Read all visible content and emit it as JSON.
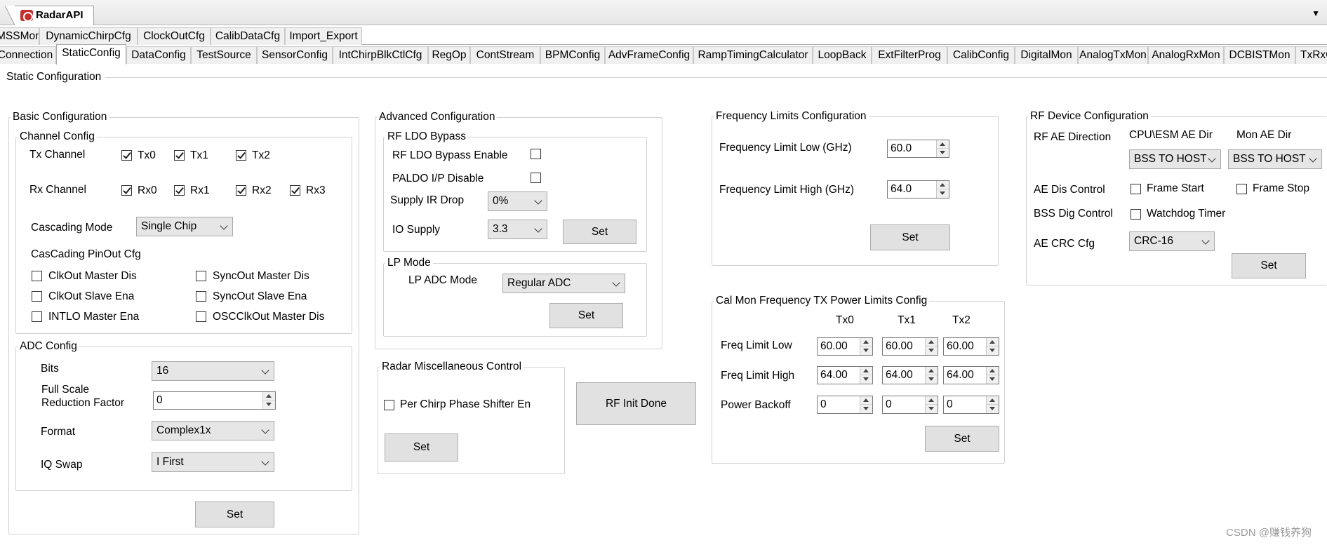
{
  "window": {
    "app_title": "RadarAPI",
    "dropdown_glyph": "▼"
  },
  "tabs_row1": [
    "MSSMon",
    "DynamicChirpCfg",
    "ClockOutCfg",
    "CalibDataCfg",
    "Import_Export"
  ],
  "tabs_row2": [
    "Connection",
    "StaticConfig",
    "DataConfig",
    "TestSource",
    "SensorConfig",
    "IntChirpBlkCtlCfg",
    "RegOp",
    "ContStream",
    "BPMConfig",
    "AdvFrameConfig",
    "RampTimingCalculator",
    "LoopBack",
    "ExtFilterProg",
    "CalibConfig",
    "DigitalMon",
    "AnalogTxMon",
    "AnalogRxMon",
    "DCBISTMon",
    "TxRxG"
  ],
  "active_tab": "StaticConfig",
  "panel_title": "Static Configuration",
  "basic": {
    "title": "Basic Configuration",
    "channel_title": "Channel Config",
    "tx_label": "Tx Channel",
    "tx": [
      {
        "label": "Tx0",
        "checked": true
      },
      {
        "label": "Tx1",
        "checked": true
      },
      {
        "label": "Tx2",
        "checked": true
      }
    ],
    "rx_label": "Rx Channel",
    "rx": [
      {
        "label": "Rx0",
        "checked": true
      },
      {
        "label": "Rx1",
        "checked": true
      },
      {
        "label": "Rx2",
        "checked": true
      },
      {
        "label": "Rx3",
        "checked": true
      }
    ],
    "cascading_label": "Cascading Mode",
    "cascading_value": "Single Chip",
    "pinout_label": "CasCading PinOut Cfg",
    "pinout": [
      "ClkOut Master Dis",
      "SyncOut Master Dis",
      "ClkOut Slave Ena",
      "SyncOut Slave Ena",
      "INTLO Master Ena",
      "OSCClkOut Master Dis"
    ],
    "adc_title": "ADC Config",
    "bits_label": "Bits",
    "bits_value": "16",
    "fsrf_label1": "Full Scale",
    "fsrf_label2": "Reduction Factor",
    "fsrf_value": "0",
    "format_label": "Format",
    "format_value": "Complex1x",
    "iq_label": "IQ Swap",
    "iq_value": "I First",
    "set": "Set"
  },
  "advanced": {
    "title": "Advanced Configuration",
    "ldo_title": "RF LDO Bypass",
    "ldo_enable": "RF LDO Bypass Enable",
    "paldo": "PALDO I/P Disable",
    "ir_drop_label": "Supply IR Drop",
    "ir_drop_value": "0%",
    "io_label": "IO Supply",
    "io_value": "3.3",
    "set": "Set",
    "lp_title": "LP Mode",
    "lp_adc_label": "LP ADC Mode",
    "lp_adc_value": "Regular ADC",
    "lp_set": "Set"
  },
  "misc": {
    "title": "Radar Miscellaneous Control",
    "per_chirp": "Per Chirp Phase Shifter En",
    "set": "Set",
    "rf_init": "RF Init Done"
  },
  "freq": {
    "title": "Frequency Limits Configuration",
    "low_label": "Frequency Limit Low (GHz)",
    "low_value": "60.0",
    "high_label": "Frequency Limit High (GHz)",
    "high_value": "64.0",
    "set": "Set"
  },
  "calmon": {
    "title": "Cal Mon Frequency TX Power Limits Config",
    "cols": [
      "Tx0",
      "Tx1",
      "Tx2"
    ],
    "rows": [
      {
        "label": "Freq Limit Low",
        "values": [
          "60.00",
          "60.00",
          "60.00"
        ]
      },
      {
        "label": "Freq Limit High",
        "values": [
          "64.00",
          "64.00",
          "64.00"
        ]
      },
      {
        "label": "Power Backoff",
        "values": [
          "0",
          "0",
          "0"
        ]
      }
    ],
    "set": "Set"
  },
  "rfdev": {
    "title": "RF Device Configuration",
    "ae_dir_label": "RF AE Direction",
    "cpu_label": "CPU\\ESM AE Dir",
    "mon_label": "Mon AE Dir",
    "cpu_value": "BSS TO HOST",
    "mon_value": "BSS TO HOST",
    "ae_dis_label": "AE Dis Control",
    "frame_start": "Frame Start",
    "frame_stop": "Frame Stop",
    "bss_dig_label": "BSS Dig Control",
    "watchdog": "Watchdog Timer",
    "crc_label": "AE CRC Cfg",
    "crc_value": "CRC-16",
    "set": "Set"
  },
  "watermark": "CSDN @赚钱养狗"
}
